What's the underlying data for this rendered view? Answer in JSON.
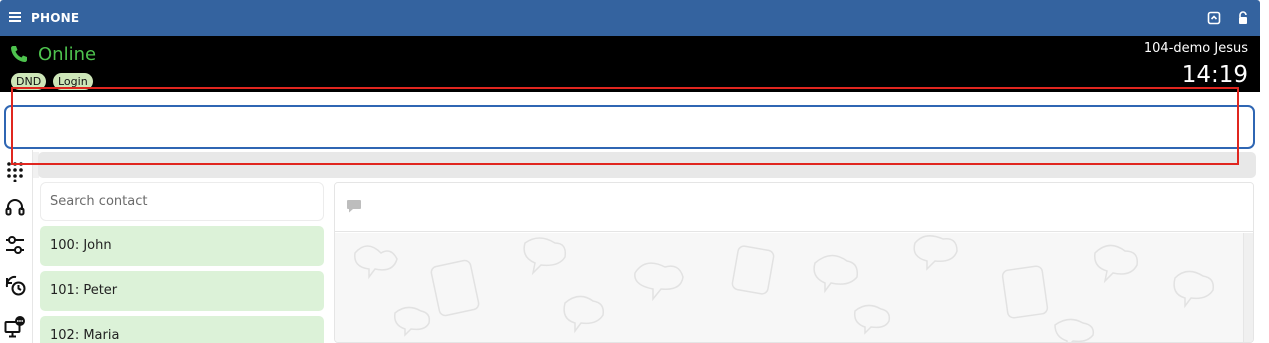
{
  "window": {
    "title": "PHONE",
    "icons": [
      "menu-icon",
      "window-box-icon",
      "lock-icon"
    ]
  },
  "status": {
    "state": "Online",
    "state_color": "#4ec34e",
    "badges": [
      "DND",
      "Login"
    ],
    "user": "104-demo Jesus",
    "time": "14:19"
  },
  "dial": {
    "value": ""
  },
  "rail": {
    "icons": [
      "dialpad-icon",
      "headset-icon",
      "settings-sliders-icon",
      "call-history-icon",
      "monitor-chat-icon"
    ]
  },
  "contacts": {
    "search_placeholder": "Search contact",
    "items": [
      {
        "label": "100: John"
      },
      {
        "label": "101: Peter"
      },
      {
        "label": "102: Maria"
      }
    ]
  },
  "chat": {
    "header_icon": "message-icon"
  },
  "colors": {
    "titlebar": "#34639f",
    "statusbar": "#000000",
    "contact_bg": "#dcf2d8",
    "input_border": "#2f66b3",
    "annotation": "#e0261f"
  }
}
